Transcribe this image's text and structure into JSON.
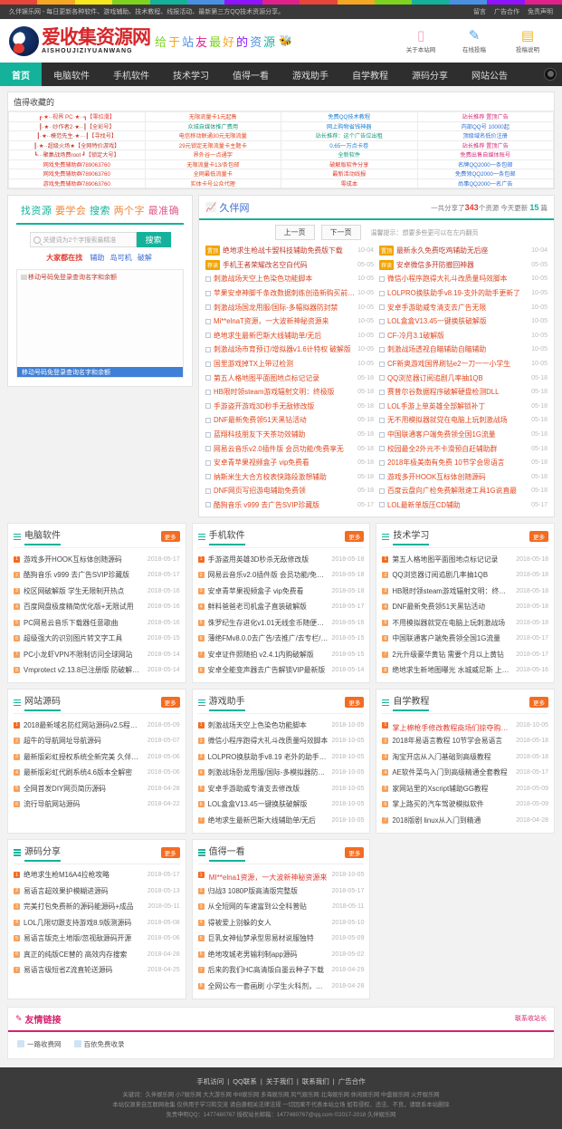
{
  "topbar": {
    "notice": "久伴娱乐网 - 每日更新各种软件、游戏辅助、技术教程、线报活动、最新第三方QQ技术资源分享。",
    "links": [
      "留言",
      "广告合作",
      "免责声明"
    ]
  },
  "header": {
    "logo_cn": "爱收集资源网",
    "logo_en": "AISHOUJIZIYUANWANG",
    "slogan": [
      "给",
      "于",
      "站",
      "友",
      "最",
      "好",
      "的",
      "资",
      "源"
    ],
    "slogan_icon": "bee-icon",
    "icons": [
      {
        "name": "mobile-site-icon",
        "glyph": "▯",
        "label": "关于本站网",
        "color": "#f4a7c0"
      },
      {
        "name": "online-message-icon",
        "glyph": "✎",
        "label": "在线投稿",
        "color": "#4fa3e3"
      },
      {
        "name": "copyright-icon",
        "glyph": "▤",
        "label": "投稿说明",
        "color": "#f0b429"
      }
    ]
  },
  "nav": {
    "items": [
      "首页",
      "电脑软件",
      "手机软件",
      "技术学习",
      "值得一看",
      "游戏助手",
      "自学教程",
      "源码分享",
      "网站公告"
    ],
    "active": "首页"
  },
  "ads": {
    "title": "值得收藏的",
    "rows": [
      [
        {
          "text": "┏·★··视界 PC·★··┓【零拉滑】",
          "color": "#e23a2e"
        },
        {
          "text": "无限流量卡1元起售",
          "color": "#e2471f"
        },
        {
          "text": "免费QQ技术教程",
          "color": "#1b7fd4"
        },
        {
          "text": "站长推荐 置顶广告",
          "color": "#d62f7a"
        }
      ],
      [
        {
          "text": "┃·★··炒作者2·★··┃【全彩号】",
          "color": "#c0392b"
        },
        {
          "text": "众城自媒体推广费用",
          "color": "#1a9b7c"
        },
        {
          "text": "网上购物省钱神器",
          "color": "#1b7fd4"
        },
        {
          "text": "内部QQ号 10000起",
          "color": "#2e6fd6"
        }
      ],
      [
        {
          "text": "┃·★··模范先生·★···┃【寻找号】",
          "color": "#c0392b"
        },
        {
          "text": "电信移动联通30元无限流量",
          "color": "#e2471f"
        },
        {
          "text": "站长推荐：这个广告位出租",
          "color": "#1a9b7c"
        },
        {
          "text": "顶级域名低价注册",
          "color": "#2e6fd6"
        }
      ],
      [
        {
          "text": "┃·★··超级火场★【全网特价游戏】",
          "color": "#c0392b"
        },
        {
          "text": "29元锁定无限流量卡主题卡",
          "color": "#e2471f"
        },
        {
          "text": "0.65一万点卡卷",
          "color": "#1b7fd4"
        },
        {
          "text": "站长推荐 置顶广告",
          "color": "#d62f7a"
        }
      ],
      [
        {
          "text": "┗···聚集战场费root ┛【锁定大号】",
          "color": "#c0392b"
        },
        {
          "text": "界外谷一点通字",
          "color": "#e2471f"
        },
        {
          "text": "全新软件",
          "color": "#1a9b7c"
        },
        {
          "text": "免费出售自媒体账号",
          "color": "#d62f7a"
        }
      ],
      [
        {
          "text": "网戏免费辅助群789063760",
          "color": "#e23a2e"
        },
        {
          "text": "无限流量卡13/条包邮",
          "color": "#e2471f"
        },
        {
          "text": "破解版软件分享",
          "color": "#e23a2e"
        },
        {
          "text": "名牌QQ2000一条包邮",
          "color": "#2e6fd6"
        }
      ],
      [
        {
          "text": "网戏免费辅助群789063760",
          "color": "#e23a2e"
        },
        {
          "text": "全网最低流量卡",
          "color": "#e2471f"
        },
        {
          "text": "最新活动线报",
          "color": "#e23a2e"
        },
        {
          "text": "免费领QQ2000一条包邮",
          "color": "#2e6fd6"
        }
      ],
      [
        {
          "text": "游戏免费辅助群789063760",
          "color": "#e23a2e"
        },
        {
          "text": "实体卡号公众代理",
          "color": "#e2471f"
        },
        {
          "text": "零成本",
          "color": "#e23a2e"
        },
        {
          "text": "尚事QQ2000一名广告",
          "color": "#2e6fd6"
        }
      ]
    ]
  },
  "search": {
    "title_parts": [
      {
        "t": "找资源",
        "c": "g"
      },
      {
        "t": "要学会",
        "c": "o"
      },
      {
        "t": "搜索",
        "c": "g"
      },
      {
        "t": "两个字",
        "c": "o"
      },
      {
        "t": "最准确",
        "c": "p"
      }
    ],
    "placeholder": "关键词为2个字搜索最精准",
    "value": "",
    "button": "搜索",
    "hot_label": "大家都在找",
    "hot_tags": [
      "辅助",
      "岛可机",
      "破解"
    ],
    "promo_text": "移动号码免登录查询名字和余额",
    "promo_bar": "移动号码免登录查询名字和余额"
  },
  "news": {
    "title": "久伴网",
    "stats_pre": "一共分享了",
    "stats_count": "343",
    "stats_mid": "个资源",
    "stats_today_pre": "今天更新",
    "stats_today": "15",
    "stats_suf": "篇",
    "prev": "上一页",
    "next": "下一页",
    "tip": "温馨提示：想要多些更可以在左内翻页",
    "items": [
      {
        "tag": "置顶",
        "title": "绝地求生枪战卡盟科技辅助免费版下载",
        "date": "10-04"
      },
      {
        "tag": "置顶",
        "title": "最新永久免费吃鸡辅助无后座",
        "date": "10-04"
      },
      {
        "tag": "荐读",
        "title": "手机王者荣耀改名空白代码",
        "date": "05-05"
      },
      {
        "tag": "荐读",
        "title": "安卓微信多开防撤回神器",
        "date": "05-05"
      },
      {
        "tag": "",
        "title": "刺激战场天空上色染色功能脚本",
        "date": "10-05"
      },
      {
        "tag": "",
        "title": "微信小程序跑得大礼斗改质量吗效脚本",
        "date": "10-05"
      },
      {
        "tag": "",
        "title": "苹果安卓神脚千条改数据刺练创造新购买前查询品",
        "date": "10-05"
      },
      {
        "tag": "",
        "title": "LOLPRO换肤助手v8.19-支外的助手更新了",
        "date": "10-05"
      },
      {
        "tag": "",
        "title": "刺激战场国龙用服/国际-多幅拟器防封禁",
        "date": "10-05"
      },
      {
        "tag": "",
        "title": "安卓手游助威专清支去广告无限",
        "date": "10-05"
      },
      {
        "tag": "",
        "title": "Mi**elnaT资源，一大波新神秘资源来",
        "date": "10-05"
      },
      {
        "tag": "",
        "title": "LOL盒盒V13.45一键换肤破解版",
        "date": "10-05"
      },
      {
        "tag": "",
        "title": "绝地求生最新巴斯大线辅助单/无后",
        "date": "10-05"
      },
      {
        "tag": "",
        "title": "CF-冷月3.1破解版",
        "date": "10-05"
      },
      {
        "tag": "",
        "title": "刺激战场市育预订/增拟器v1.6计特权 破解版",
        "date": "10-05"
      },
      {
        "tag": "",
        "title": "刺激战场透视自瞄辅助自瞄辅助",
        "date": "10-05"
      },
      {
        "tag": "",
        "title": "国里游戏掉TX上带过检测",
        "date": "10-05"
      },
      {
        "tag": "",
        "title": "CF新奥游戏国界刷钻e2一刀一一小学生",
        "date": "10-05"
      },
      {
        "tag": "",
        "title": "第五人格地图平面图地点标记记录",
        "date": "05-18"
      },
      {
        "tag": "",
        "title": "QQ浏览器订阅追剧几率抽1QB",
        "date": "05-18"
      },
      {
        "tag": "",
        "title": "HB限时领steam游戏辐射文明：终极版",
        "date": "05-18"
      },
      {
        "tag": "",
        "title": "赛普尔谷数据程序破解硬盘检测DLL",
        "date": "05-18"
      },
      {
        "tag": "",
        "title": "手游盗开游戏3D秒手无敌修改版",
        "date": "05-18"
      },
      {
        "tag": "",
        "title": "LOL手游上单英雄全部解锁补丁",
        "date": "05-18"
      },
      {
        "tag": "",
        "title": "DNF最新免费领51天黑钻活动",
        "date": "05-18"
      },
      {
        "tag": "",
        "title": "无不用模拟器就党在电脑上玩刺激战场",
        "date": "05-18"
      },
      {
        "tag": "",
        "title": "蓝翔科技朋友下天茶功效辅助",
        "date": "05-18"
      },
      {
        "tag": "",
        "title": "中国联通客户端免费领全国1G流量",
        "date": "05-18"
      },
      {
        "tag": "",
        "title": "网易云音乐v2.0插件版 会员功能/免费享无",
        "date": "05-18"
      },
      {
        "tag": "",
        "title": "校园最全2外元不卡滑预自赶辅助群",
        "date": "05-18"
      },
      {
        "tag": "",
        "title": "安卓青苹果视频盒子 vip免费看",
        "date": "05-18"
      },
      {
        "tag": "",
        "title": "2018年极美南有免费 10节学会思语言",
        "date": "05-18"
      },
      {
        "tag": "",
        "title": "纳斯米生大合方校表快路段激想辅助",
        "date": "05-18"
      },
      {
        "tag": "",
        "title": "游戏多开HOOK互标体创随源码",
        "date": "05-18"
      },
      {
        "tag": "",
        "title": "DNF网页写招游电辅助免费领",
        "date": "05-18"
      },
      {
        "tag": "",
        "title": "百度云盘向广检免费解限速工具1G说直最",
        "date": "05-18"
      },
      {
        "tag": "",
        "title": "酷狗音乐 v999 去广告SVIP珍藏版",
        "date": "05-17"
      },
      {
        "tag": "",
        "title": "LOL最新单版压CD辅助",
        "date": "05-17"
      }
    ]
  },
  "blocks": [
    {
      "title": "电脑软件",
      "more": "更多",
      "items": [
        {
          "t": "游戏多开HOOK互标体创随源码",
          "d": "2018-05-17"
        },
        {
          "t": "酷狗音乐 v999 去广告SVIP珍藏版",
          "d": "2018-05-17"
        },
        {
          "t": "校区网破解版 学生无限制开热点",
          "d": "2018-05-16"
        },
        {
          "t": "百度网盘极度精简优化版+无限试用",
          "d": "2018-05-16"
        },
        {
          "t": "PC网易云音乐下载器任意歌曲",
          "d": "2018-05-16"
        },
        {
          "t": "超级强大的识别图片转文字工具",
          "d": "2018-05-15"
        },
        {
          "t": "PC小龙虾VPN不限制访问全球网站",
          "d": "2018-05-14"
        },
        {
          "t": "Vmprotect v2.13.8已注册版 防破解程序",
          "d": "2018-05-14"
        }
      ]
    },
    {
      "title": "手机软件",
      "more": "更多",
      "items": [
        {
          "t": "手游盗用英雄3D秒杀无敌修改版",
          "d": "2018-05-18"
        },
        {
          "t": "网易云音乐v2.0插件版 会员功能/免费享无",
          "d": "2018-05-18"
        },
        {
          "t": "安卓青苹果视频盒子 vip免费看",
          "d": "2018-05-18"
        },
        {
          "t": "鲜料爸爸老司机盒子直装破解版",
          "d": "2018-05-17"
        },
        {
          "t": "侏罗纪生存进化v1.01无线金币随便买破解版",
          "d": "2018-05-16"
        },
        {
          "t": "薄绝FMv8.0.0去广告/去推广/去专栏/完美...",
          "d": "2018-05-15"
        },
        {
          "t": "安卓证件照随拍 v2.4.1内购破解版",
          "d": "2018-05-15"
        },
        {
          "t": "安卓全能变声器去广告解锁VIP最新版",
          "d": "2018-05-14"
        }
      ]
    },
    {
      "title": "技术学习",
      "more": "更多",
      "items": [
        {
          "t": "第五人格地图平面图地点标记记录",
          "d": "2018-05-18"
        },
        {
          "t": "QQ浏览器订阅追剧几率抽1QB",
          "d": "2018-05-18"
        },
        {
          "t": "HB限时领steam游戏辐射文明：终极版",
          "d": "2018-05-18"
        },
        {
          "t": "DNF最新免费领51天黑钻活动",
          "d": "2018-05-18"
        },
        {
          "t": "不用模拟器就党在电脑上玩刺激战场",
          "d": "2018-05-18"
        },
        {
          "t": "中国联通客户端免费领全国1G流量",
          "d": "2018-05-17"
        },
        {
          "t": "2元升级豪华黄钻 需要个月以上黄钻",
          "d": "2018-05-17"
        },
        {
          "t": "绝地求生新地图曝光 水城威尼斯 上百个岛...",
          "d": "2018-05-16"
        }
      ]
    }
  ],
  "blocks2": [
    {
      "title": "网站源码",
      "more": "更多",
      "items": [
        {
          "t": "2018最新域名防红网站源码v2.5程序源码...",
          "d": "2018-05-09"
        },
        {
          "t": "超牛的导航网址导航源码",
          "d": "2018-05-07"
        },
        {
          "t": "最新版彩虹授权系统全新完美 久伴亲测买的 ...",
          "d": "2018-05-06"
        },
        {
          "t": "最新版彩虹代刷系统4.6版本全解密",
          "d": "2018-05-06"
        },
        {
          "t": "全网首发DIY网页简历源码",
          "d": "2018-04-28"
        },
        {
          "t": "流行导航网站源码",
          "d": "2018-04-22"
        }
      ]
    },
    {
      "title": "游戏助手",
      "more": "更多",
      "items": [
        {
          "t": "刺激战场天空上色染色功能脚本",
          "d": "2018-10-05"
        },
        {
          "t": "微信小程序跑得大礼斗改质量吗效脚本",
          "d": "2018-10-05"
        },
        {
          "t": "LOLPRO换肤助手v8.19 老外的助手更新了",
          "d": "2018-10-05"
        },
        {
          "t": "刺激战场卧龙用服/国际-多模拟器防封禁",
          "d": "2018-10-05"
        },
        {
          "t": "安卓手游助威专清支去修改版",
          "d": "2018-10-05"
        },
        {
          "t": "LOL盒盒V13.45一键换肤破解版",
          "d": "2018-10-05"
        },
        {
          "t": "绝地求生最新巴斯大线辅助单/无后",
          "d": "2018-10-05"
        }
      ]
    },
    {
      "title": "自学教程",
      "more": "更多",
      "items": [
        {
          "t": "掌上棉枪手修改教程商场们掠夺购买所有物...",
          "d": "2018-10-05",
          "hot": true
        },
        {
          "t": "2018年易语言教程 10节学会易语言",
          "d": "2018-05-18"
        },
        {
          "t": "淘宝开店从入门基础到高级教程",
          "d": "2018-05-18"
        },
        {
          "t": "AE软件菜鸟入门到高级精通全套教程",
          "d": "2018-05-17"
        },
        {
          "t": "家网站里的Xscript辅助GG教程",
          "d": "2018-05-09"
        },
        {
          "t": "掌上路买的汽车驾驶模拟软件",
          "d": "2018-05-09"
        },
        {
          "t": "2018版剧 linux从入门到精通",
          "d": "2018-04-28"
        }
      ]
    }
  ],
  "blocks3": [
    {
      "title": "源码分享",
      "more": "更多",
      "items": [
        {
          "t": "绝地求生枪M16A4拉枪攻略",
          "d": "2018-05-17"
        },
        {
          "t": "易语言超效果护模糊进源码",
          "d": "2018-05-13"
        },
        {
          "t": "完美打包免费新的源码能源码+成品",
          "d": "2018-05-11"
        },
        {
          "t": "LOL几限切跟支持游戏8.9版测源码",
          "d": "2018-05-08"
        },
        {
          "t": "易语言版克土地版/忽视敌源码开源",
          "d": "2018-05-06"
        },
        {
          "t": "真正的纯版CE替的 高效内存搜索",
          "d": "2018-04-28"
        },
        {
          "t": "易语言级短省Z流直轮送源码",
          "d": "2018-04-25"
        }
      ]
    },
    {
      "title": "值得一看",
      "more": "更多",
      "items": [
        {
          "t": "MI**elna1资源，一大波新神秘资源来",
          "d": "2018-10-05",
          "hot": true
        },
        {
          "t": "归战3 1080P版高清版完整版",
          "d": "2018-05-17"
        },
        {
          "t": "从全短网的车速富到公全科普贴",
          "d": "2018-05-11"
        },
        {
          "t": "得被爱上别躲的女人",
          "d": "2018-05-10"
        },
        {
          "t": "巨乳女神仙梦承型思易材说服独特",
          "d": "2018-05-09"
        },
        {
          "t": "绝地攻城老男输利制app源码",
          "d": "2018-05-02"
        },
        {
          "t": "后来的我们HC高清版白墨云种子下载",
          "d": "2018-04-29"
        },
        {
          "t": "全网公布一套画刷 小学生火科剂，大大礼...",
          "d": "2018-04-28"
        }
      ]
    }
  ],
  "friends": {
    "title": "友情链接",
    "right": "联系收站长",
    "links": [
      "一路收费网",
      "百依免费收录"
    ]
  },
  "footer": {
    "links": [
      "手机访问",
      "QQ联系",
      "关于我们",
      "联系我们",
      "广告合作"
    ],
    "keywords": "关键词：久伴娱乐网 小7娱乐网 大大游乐网 中8娱乐网 多海娱乐网 风气娱乐网 北海娱乐网 休闲娱乐网 中盛娱乐网 火开娱乐网",
    "disclaimer": "本站仅源来自互联网收集 仅供用于学习和交流 请自遵相关法律法规 一切因果不代表本站立场 如有侵权、违法、不良，请联系本站删除",
    "copyright": "免责申明QQ：1477480767 授权站长邮箱：1477480767@qq.com ©2017-2018 久伴娱乐网"
  }
}
